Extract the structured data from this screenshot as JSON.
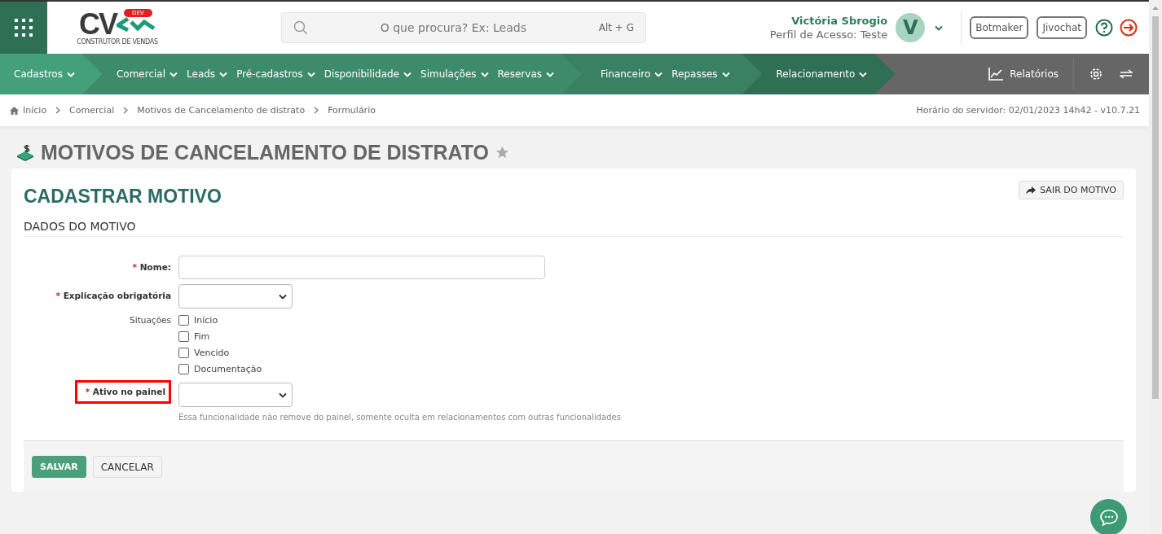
{
  "header": {
    "logo": {
      "letters": "CV",
      "badge": "DEV",
      "tagline": "CONSTRUTOR DE VENDAS"
    },
    "search": {
      "placeholder": "O que procura? Ex: Leads",
      "shortcut": "Alt + G"
    },
    "user": {
      "name": "Victória Sbrogio",
      "profile": "Perfil de Acesso: Teste",
      "avatar_initial": "V"
    },
    "buttons": [
      "Botmaker",
      "Jivochat"
    ]
  },
  "nav": {
    "groups": [
      {
        "color": "#43a07a",
        "items": [
          "Cadastros"
        ]
      },
      {
        "color": "#3d8b6a",
        "items": [
          "Comercial",
          "Leads",
          "Pré-cadastros",
          "Disponibilidade",
          "Simulações",
          "Reservas"
        ]
      },
      {
        "color": "#3a8063",
        "items": [
          "Financeiro",
          "Repasses"
        ]
      },
      {
        "color": "#2f6f54",
        "items": [
          "Relacionamento"
        ]
      }
    ],
    "reports": "Relatórios"
  },
  "breadcrumb": {
    "items": [
      "Início",
      "Comercial",
      "Motivos de Cancelamento de distrato",
      "Formulário"
    ],
    "server_info": "Horário do servidor: 02/01/2023 14h42 - v10.7.21"
  },
  "page_title": "MOTIVOS DE CANCELAMENTO DE DISTRATO",
  "favorite": false,
  "form": {
    "title": "CADASTRAR MOTIVO",
    "exit_button": "SAIR DO MOTIVO",
    "section": "DADOS DO MOTIVO",
    "fields": [
      {
        "kind": "text",
        "required_mark": "*",
        "label": "Nome:",
        "highlighted": false
      },
      {
        "kind": "select",
        "required_mark": "*",
        "label": "Explicação obrigatória",
        "highlighted": false
      },
      {
        "kind": "checkboxes",
        "label": "Situações",
        "highlighted": false,
        "options": [
          {
            "label": "Início",
            "checked": false
          },
          {
            "label": "Fim",
            "checked": false
          },
          {
            "label": "Vencido",
            "checked": false
          },
          {
            "label": "Documentação",
            "checked": false
          }
        ]
      },
      {
        "kind": "select",
        "required_mark": "*",
        "label": "Ativo no painel",
        "highlighted": true,
        "help": "Essa funcionalidade não remove do painel, somente oculta em relacionamentos com outras funcionalidades"
      }
    ],
    "save_button": "SALVAR",
    "cancel_button": "CANCELAR"
  }
}
